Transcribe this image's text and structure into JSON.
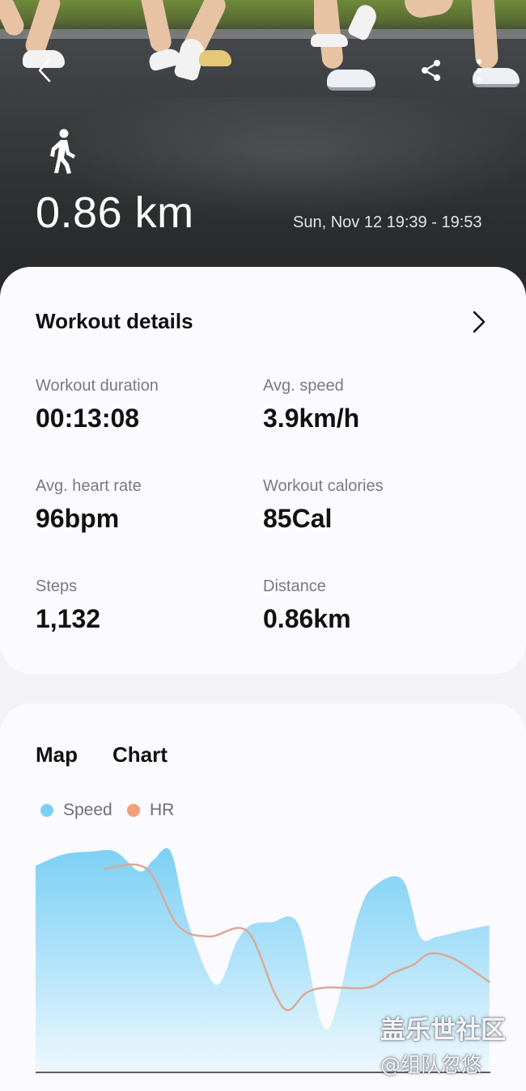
{
  "header": {
    "distance": "0.86 km",
    "date_range": "Sun, Nov 12 19:39 - 19:53",
    "icons": [
      "back-arrow-icon",
      "share-icon",
      "more-vertical-icon",
      "walking-icon"
    ]
  },
  "details": {
    "title": "Workout details",
    "metrics": [
      {
        "label": "Workout duration",
        "value": "00:13:08",
        "unit": ""
      },
      {
        "label": "Avg. speed",
        "value": "3.9",
        "unit": "km/h"
      },
      {
        "label": "Avg. heart rate",
        "value": "96",
        "unit": "bpm"
      },
      {
        "label": "Workout calories",
        "value": "85",
        "unit": "Cal"
      },
      {
        "label": "Steps",
        "value": "1,132",
        "unit": ""
      },
      {
        "label": "Distance",
        "value": "0.86",
        "unit": "km"
      }
    ]
  },
  "chart_section": {
    "tabs": [
      "Map",
      "Chart"
    ],
    "legend": [
      {
        "label": "Speed",
        "color": "#7dd0f5"
      },
      {
        "label": "HR",
        "color": "#f1a07a"
      }
    ]
  },
  "chart_data": {
    "type": "area",
    "series": [
      {
        "name": "Speed",
        "color": "#7dd0f5",
        "x": [
          0,
          0.8,
          1.6,
          2.3,
          3.0,
          3.4,
          3.9,
          4.4,
          5.2,
          5.8,
          6.2,
          6.8,
          7.6,
          8.4,
          9.3,
          9.8,
          10.6,
          11.1,
          11.6,
          12.3,
          13.1
        ],
        "values": [
          0.73,
          0.77,
          0.78,
          0.78,
          0.71,
          0.75,
          0.78,
          0.53,
          0.31,
          0.46,
          0.52,
          0.53,
          0.52,
          0.15,
          0.55,
          0.66,
          0.68,
          0.48,
          0.48,
          0.5,
          0.52
        ]
      },
      {
        "name": "HR",
        "color": "#d8aa98",
        "x": [
          2.0,
          3.2,
          4.1,
          5.0,
          6.1,
          6.9,
          7.3,
          7.8,
          8.4,
          9.6,
          10.3,
          10.9,
          11.4,
          12.1,
          13.1
        ],
        "values": [
          0.72,
          0.72,
          0.52,
          0.48,
          0.5,
          0.28,
          0.22,
          0.28,
          0.3,
          0.3,
          0.35,
          0.38,
          0.42,
          0.4,
          0.32
        ]
      }
    ],
    "xlim": [
      0,
      13.13
    ],
    "ylim": [
      0,
      1
    ]
  },
  "watermark": {
    "line1": "盖乐世社区",
    "line2": "@组队忽悠"
  }
}
